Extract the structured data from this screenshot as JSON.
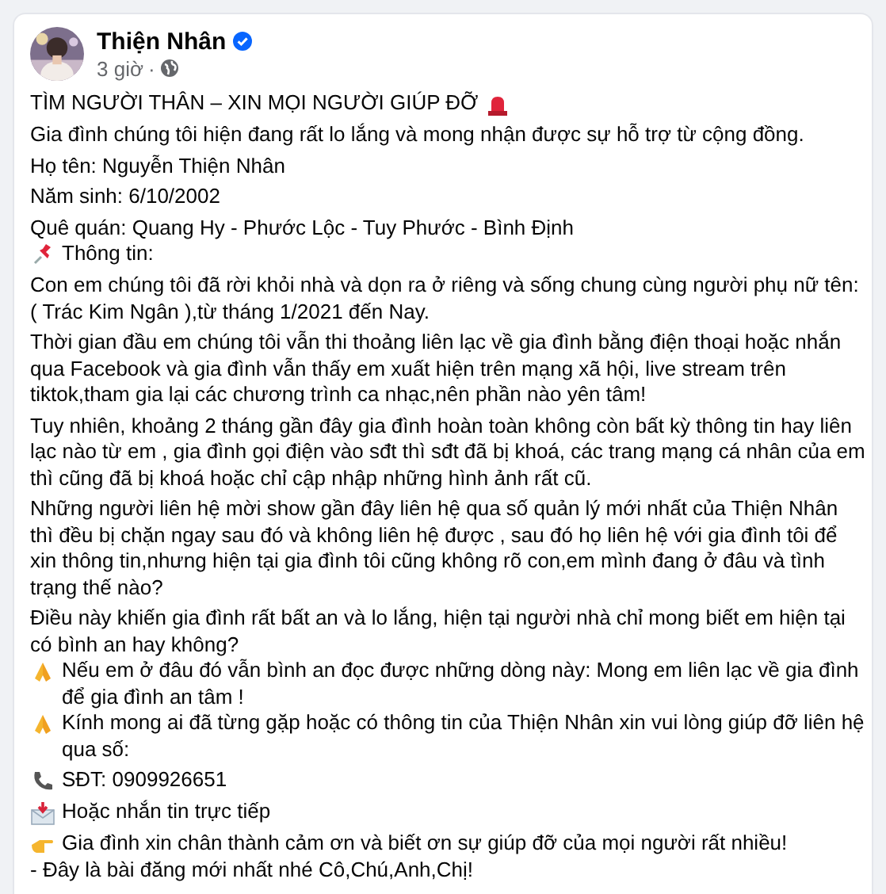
{
  "post": {
    "author": "Thiện Nhân",
    "verified": true,
    "time": "3 giờ",
    "separator": "·",
    "blocks": [
      {
        "lines": [
          {
            "text": "TÌM NGƯỜI THÂN – XIN MỌI NGƯỜI GIÚP ĐỠ",
            "kind": "alert"
          }
        ]
      },
      {
        "lines": [
          {
            "text": "Gia đình chúng tôi hiện đang rất lo lắng và mong nhận được sự hỗ trợ từ cộng đồng."
          }
        ]
      },
      {
        "lines": [
          {
            "text": "Họ tên: Nguyễn Thiện Nhân"
          }
        ]
      },
      {
        "lines": [
          {
            "text": "Năm sinh: 6/10/2002"
          }
        ]
      },
      {
        "lines": [
          {
            "text": "Quê quán: Quang Hy - Phước Lộc - Tuy Phước - Bình Định"
          },
          {
            "text": "Thông tin:",
            "kind": "pin"
          }
        ]
      },
      {
        "lines": [
          {
            "text": "Con em chúng tôi đã rời khỏi nhà và dọn ra ở riêng và sống chung cùng người phụ nữ tên:( Trác Kim Ngân ),từ tháng 1/2021 đến Nay."
          }
        ]
      },
      {
        "lines": [
          {
            "text": "Thời gian đầu em chúng tôi vẫn thi thoảng liên lạc về gia đình bằng điện thoại hoặc nhắn qua Facebook và gia đình vẫn thấy em xuất hiện trên mạng xã hội, live stream trên tiktok,tham gia lại các chương trình ca nhạc,nên phần nào yên tâm!"
          }
        ]
      },
      {
        "lines": [
          {
            "text": "Tuy nhiên, khoảng 2 tháng gần đây gia đình hoàn toàn không còn bất kỳ thông tin hay liên lạc nào từ em , gia đình gọi điện vào sđt thì sđt đã bị khoá, các trang mạng cá nhân của em thì cũng đã bị khoá hoặc chỉ cập nhập những hình ảnh rất cũ."
          }
        ]
      },
      {
        "lines": [
          {
            "text": "Những người liên hệ mời show gần đây liên hệ qua số quản lý mới nhất của Thiện Nhân thì đều bị chặn ngay sau đó và không liên hệ được , sau đó họ liên hệ với gia đình tôi để xin thông tin,nhưng hiện tại gia đình tôi cũng không rõ con,em mình đang ở đâu và tình trạng thế nào?"
          }
        ]
      },
      {
        "lines": [
          {
            "text": "Điều này khiến gia đình rất bất an và lo lắng, hiện tại người nhà chỉ mong biết em hiện tại có bình an hay không?"
          },
          {
            "text": "Nếu em ở đâu đó vẫn bình an đọc được những dòng này: Mong em liên lạc về gia đình để gia đình an tâm !",
            "kind": "pray"
          },
          {
            "text": "Kính mong ai đã từng gặp hoặc có thông tin của Thiện Nhân xin vui lòng giúp đỡ liên hệ qua số:",
            "kind": "pray"
          }
        ]
      },
      {
        "lines": [
          {
            "text": "SĐT: 0909926651",
            "kind": "phone"
          }
        ]
      },
      {
        "lines": [
          {
            "text": "Hoặc nhắn tin trực tiếp",
            "kind": "envelope"
          }
        ]
      },
      {
        "lines": [
          {
            "text": "Gia đình xin chân thành cảm ơn và biết ơn sự giúp đỡ của mọi người rất nhiều!",
            "kind": "point"
          },
          {
            "text": "- Đây là bài đăng mới nhất nhé Cô,Chú,Anh,Chị!"
          }
        ]
      }
    ]
  }
}
